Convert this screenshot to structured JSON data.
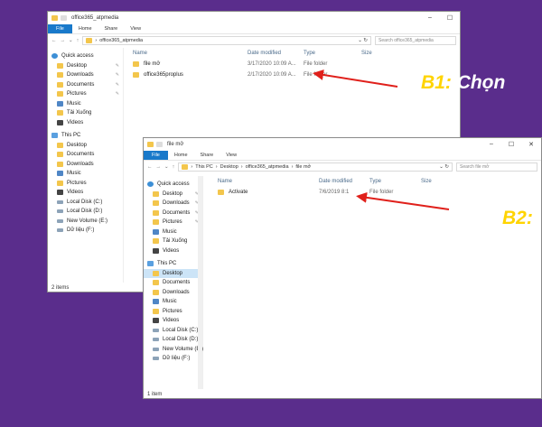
{
  "window1": {
    "title": "office365_atpmedia",
    "ribbon_tabs": [
      "File",
      "Home",
      "Share",
      "View"
    ],
    "address": "office365_atpmedia",
    "search_placeholder": "Search office365_atpmedia",
    "nav": [
      {
        "label": "Quick access",
        "icon": "star-icon",
        "top": true
      },
      {
        "label": "Desktop",
        "icon": "folder-icon",
        "pin": true
      },
      {
        "label": "Downloads",
        "icon": "folder-icon",
        "pin": true
      },
      {
        "label": "Documents",
        "icon": "folder-icon",
        "pin": true
      },
      {
        "label": "Pictures",
        "icon": "folder-icon",
        "pin": true
      },
      {
        "label": "Music",
        "icon": "music-icon"
      },
      {
        "label": "Tải Xuống",
        "icon": "folder-icon"
      },
      {
        "label": "Videos",
        "icon": "video-icon"
      },
      {
        "label": "This PC",
        "icon": "pc-icon",
        "top": true
      },
      {
        "label": "Desktop",
        "icon": "folder-icon"
      },
      {
        "label": "Documents",
        "icon": "folder-icon"
      },
      {
        "label": "Downloads",
        "icon": "folder-icon"
      },
      {
        "label": "Music",
        "icon": "music-icon"
      },
      {
        "label": "Pictures",
        "icon": "folder-icon"
      },
      {
        "label": "Videos",
        "icon": "video-icon"
      },
      {
        "label": "Local Disk (C:)",
        "icon": "drive-icon"
      },
      {
        "label": "Local Disk (D:)",
        "icon": "drive-icon"
      },
      {
        "label": "New Volume (E:)",
        "icon": "drive-icon"
      },
      {
        "label": "Dữ liệu (F:)",
        "icon": "drive-icon"
      }
    ],
    "columns": [
      "Name",
      "Date modified",
      "Type",
      "Size"
    ],
    "rows": [
      {
        "name": "file mở",
        "date": "3/17/2020 10:09 A...",
        "type": "File folder"
      },
      {
        "name": "office365proplus",
        "date": "2/17/2020 10:09 A...",
        "type": "File folder"
      }
    ],
    "status": "2 items"
  },
  "window2": {
    "title": "file mở",
    "ribbon_tabs": [
      "File",
      "Home",
      "Share",
      "View"
    ],
    "breadcrumb": [
      "This PC",
      "Desktop",
      "office365_atpmedia",
      "file mở"
    ],
    "search_placeholder": "Search file mở",
    "nav": [
      {
        "label": "Quick access",
        "icon": "star-icon",
        "top": true
      },
      {
        "label": "Desktop",
        "icon": "folder-icon",
        "pin": true
      },
      {
        "label": "Downloads",
        "icon": "folder-icon",
        "pin": true
      },
      {
        "label": "Documents",
        "icon": "folder-icon",
        "pin": true
      },
      {
        "label": "Pictures",
        "icon": "folder-icon",
        "pin": true
      },
      {
        "label": "Music",
        "icon": "music-icon"
      },
      {
        "label": "Tải Xuống",
        "icon": "folder-icon"
      },
      {
        "label": "Videos",
        "icon": "video-icon"
      },
      {
        "label": "This PC",
        "icon": "pc-icon",
        "top": true
      },
      {
        "label": "Desktop",
        "icon": "folder-icon",
        "selected": true
      },
      {
        "label": "Documents",
        "icon": "folder-icon"
      },
      {
        "label": "Downloads",
        "icon": "folder-icon"
      },
      {
        "label": "Music",
        "icon": "music-icon"
      },
      {
        "label": "Pictures",
        "icon": "folder-icon"
      },
      {
        "label": "Videos",
        "icon": "video-icon"
      },
      {
        "label": "Local Disk (C:)",
        "icon": "drive-icon"
      },
      {
        "label": "Local Disk (D:)",
        "icon": "drive-icon"
      },
      {
        "label": "New Volume (E:)",
        "icon": "drive-icon"
      },
      {
        "label": "Dữ liệu (F:)",
        "icon": "drive-icon"
      }
    ],
    "columns": [
      "Name",
      "Date modified",
      "Type",
      "Size"
    ],
    "rows": [
      {
        "name": "Activate",
        "date": "7/6/2019 8:1",
        "type": "File folder"
      }
    ],
    "status": "1 item"
  },
  "callouts": [
    {
      "step": "B1:",
      "text": "Chọn"
    },
    {
      "step": "B2:",
      "text": ""
    }
  ],
  "colors": {
    "background": "#5a2d8c",
    "callout": "#ffd400",
    "arrow": "#e0201b",
    "file_tab": "#1979ca"
  }
}
